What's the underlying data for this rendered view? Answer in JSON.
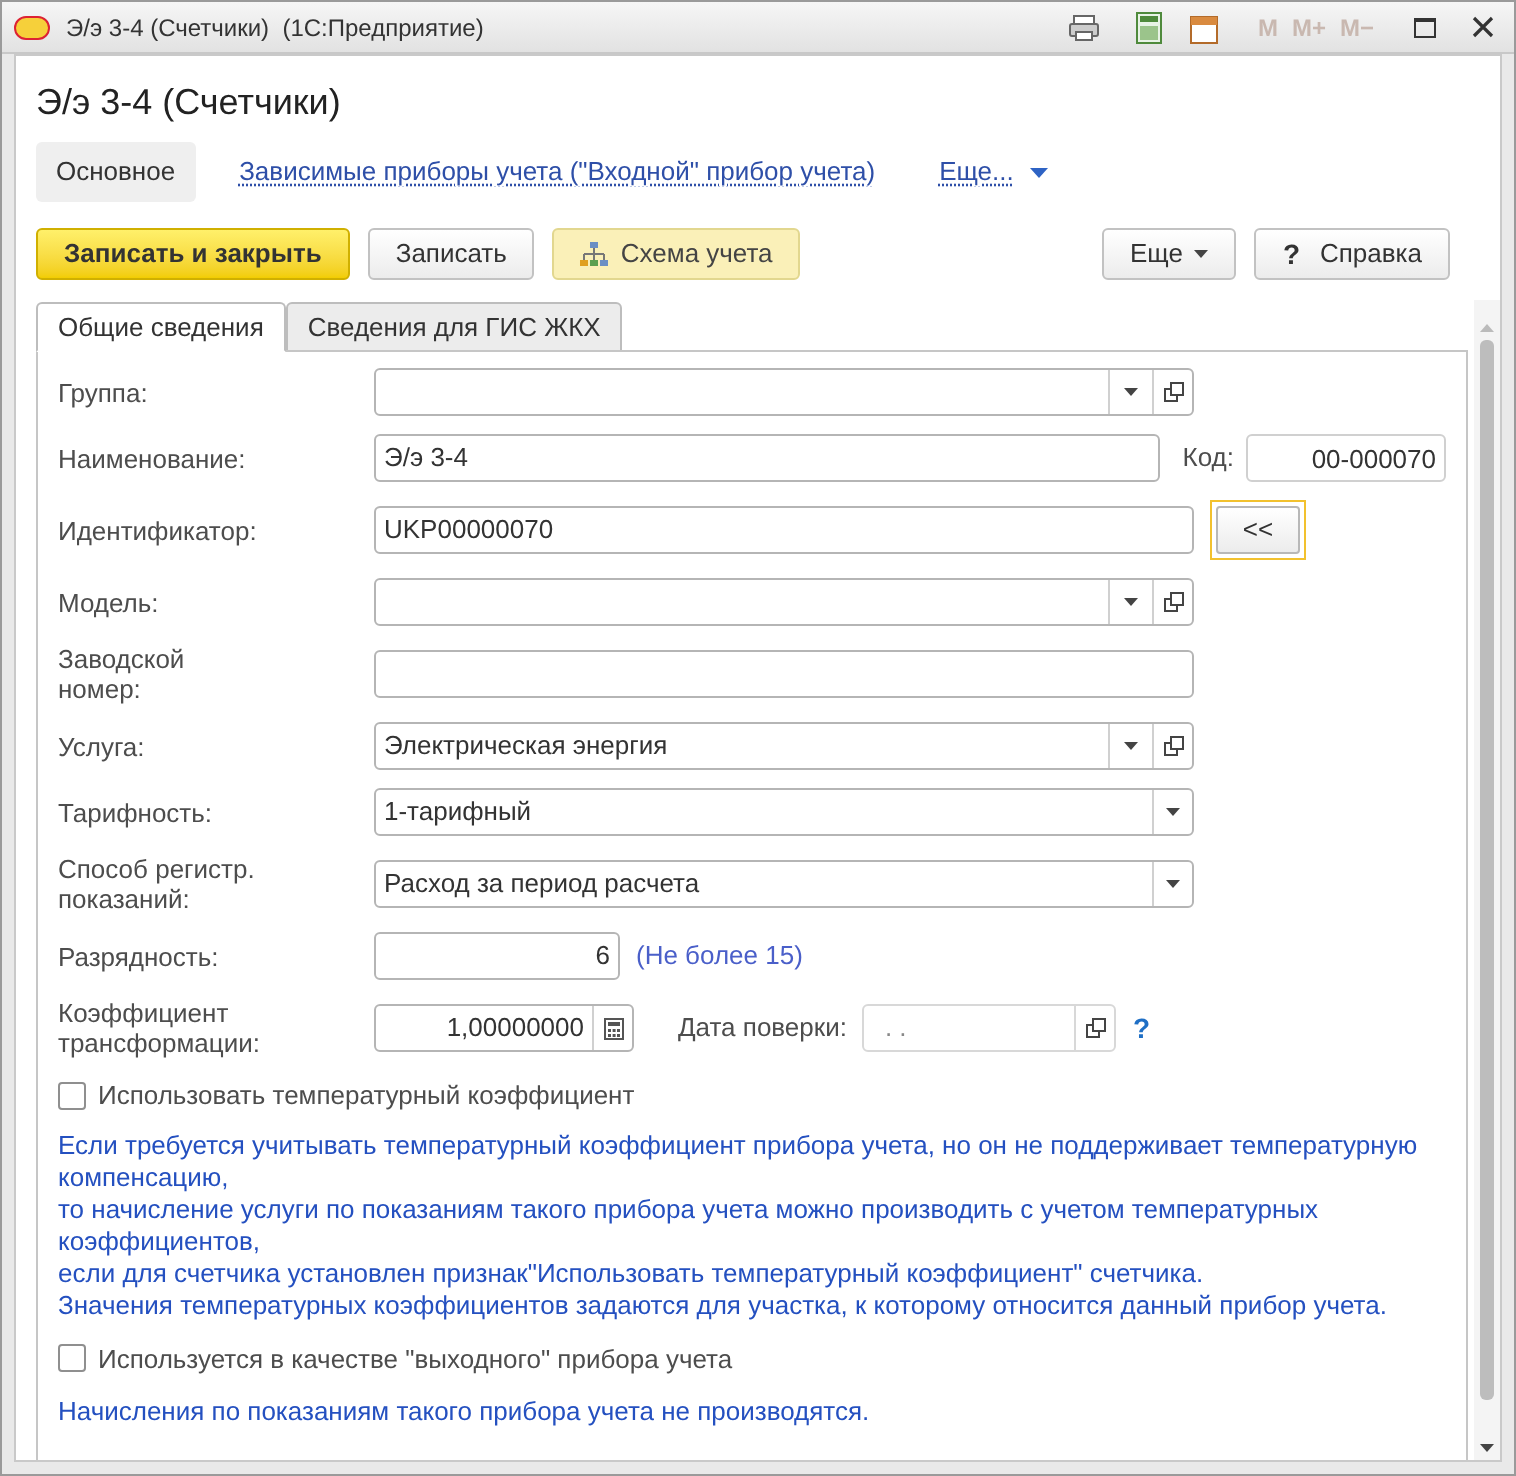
{
  "window": {
    "title": "Э/э 3-4 (Счетчики)  (1С:Предприятие)",
    "memory_buttons": [
      {
        "label": "M",
        "disabled": true
      },
      {
        "label": "M+",
        "disabled": true
      },
      {
        "label": "M−",
        "disabled": true
      }
    ]
  },
  "form_title": "Э/э 3-4 (Счетчики)",
  "nav": [
    {
      "label": "Основное",
      "selected": true,
      "kind": "section"
    },
    {
      "label": "Зависимые приборы учета (\"Входной\" прибор учета)",
      "selected": false,
      "kind": "section"
    },
    {
      "label": "Еще...",
      "selected": false,
      "kind": "more"
    }
  ],
  "toolbar": [
    {
      "label": "Записать и закрыть",
      "kind": "primary"
    },
    {
      "label": "Записать",
      "kind": "plain"
    },
    {
      "label": "Схема учета",
      "kind": "scheme"
    },
    {
      "label": "Еще",
      "kind": "menu"
    },
    {
      "label": "Справка",
      "kind": "help",
      "icon": "?"
    }
  ],
  "tabs": [
    {
      "label": "Общие сведения",
      "selected": true
    },
    {
      "label": "Сведения для ГИС ЖКХ",
      "selected": false
    }
  ],
  "fields": [
    {
      "label": "Группа:",
      "kind": "combo"
    },
    {
      "label": "Наименование:",
      "kind": "text",
      "value": "Э/э 3-4",
      "extra": {
        "label": "Код:",
        "value": "00-000070"
      }
    },
    {
      "label": "Идентификатор:",
      "kind": "text",
      "value": "UKP00000070",
      "button": {
        "label": "<<",
        "focused": true
      }
    },
    {
      "label": "Модель:",
      "kind": "combo"
    },
    {
      "label": "Заводской номер:",
      "kind": "text"
    },
    {
      "label": "Услуга:",
      "kind": "combo",
      "value": "Электрическая энергия"
    },
    {
      "label": "Тарифность:",
      "kind": "select",
      "value": "1-тарифный"
    },
    {
      "label": "Способ регистр. показаний:",
      "kind": "select",
      "value": "Расход за период расчета"
    },
    {
      "label": "Разрядность:",
      "kind": "number",
      "value": "6",
      "hint": "(Не более 15)"
    },
    {
      "label": "Коэффициент трансформации:",
      "kind": "calc",
      "value": "1,00000000",
      "date": {
        "label": "Дата поверки:",
        "placeholder": ". .",
        "help": "?"
      }
    }
  ],
  "checkbox_1": {
    "label": "Использовать температурный коэффициент",
    "checked": false
  },
  "note_1": [
    "Если требуется учитывать температурный коэффициент прибора учета, но он не поддерживает температурную компенсацию,",
    "то начисление услуги по показаниям такого прибора учета можно производить с учетом температурных коэффициентов,",
    "если для счетчика установлен признак\"Использовать температурный коэффициент\" счетчика.",
    "Значения температурных коэффициентов задаются для участка, к которому относится данный прибор учета."
  ],
  "checkbox_2": {
    "label": "Используется в качестве \"выходного\" прибора учета",
    "checked": false
  },
  "note_2": "Начисления по показаниям такого прибора учета не производятся."
}
